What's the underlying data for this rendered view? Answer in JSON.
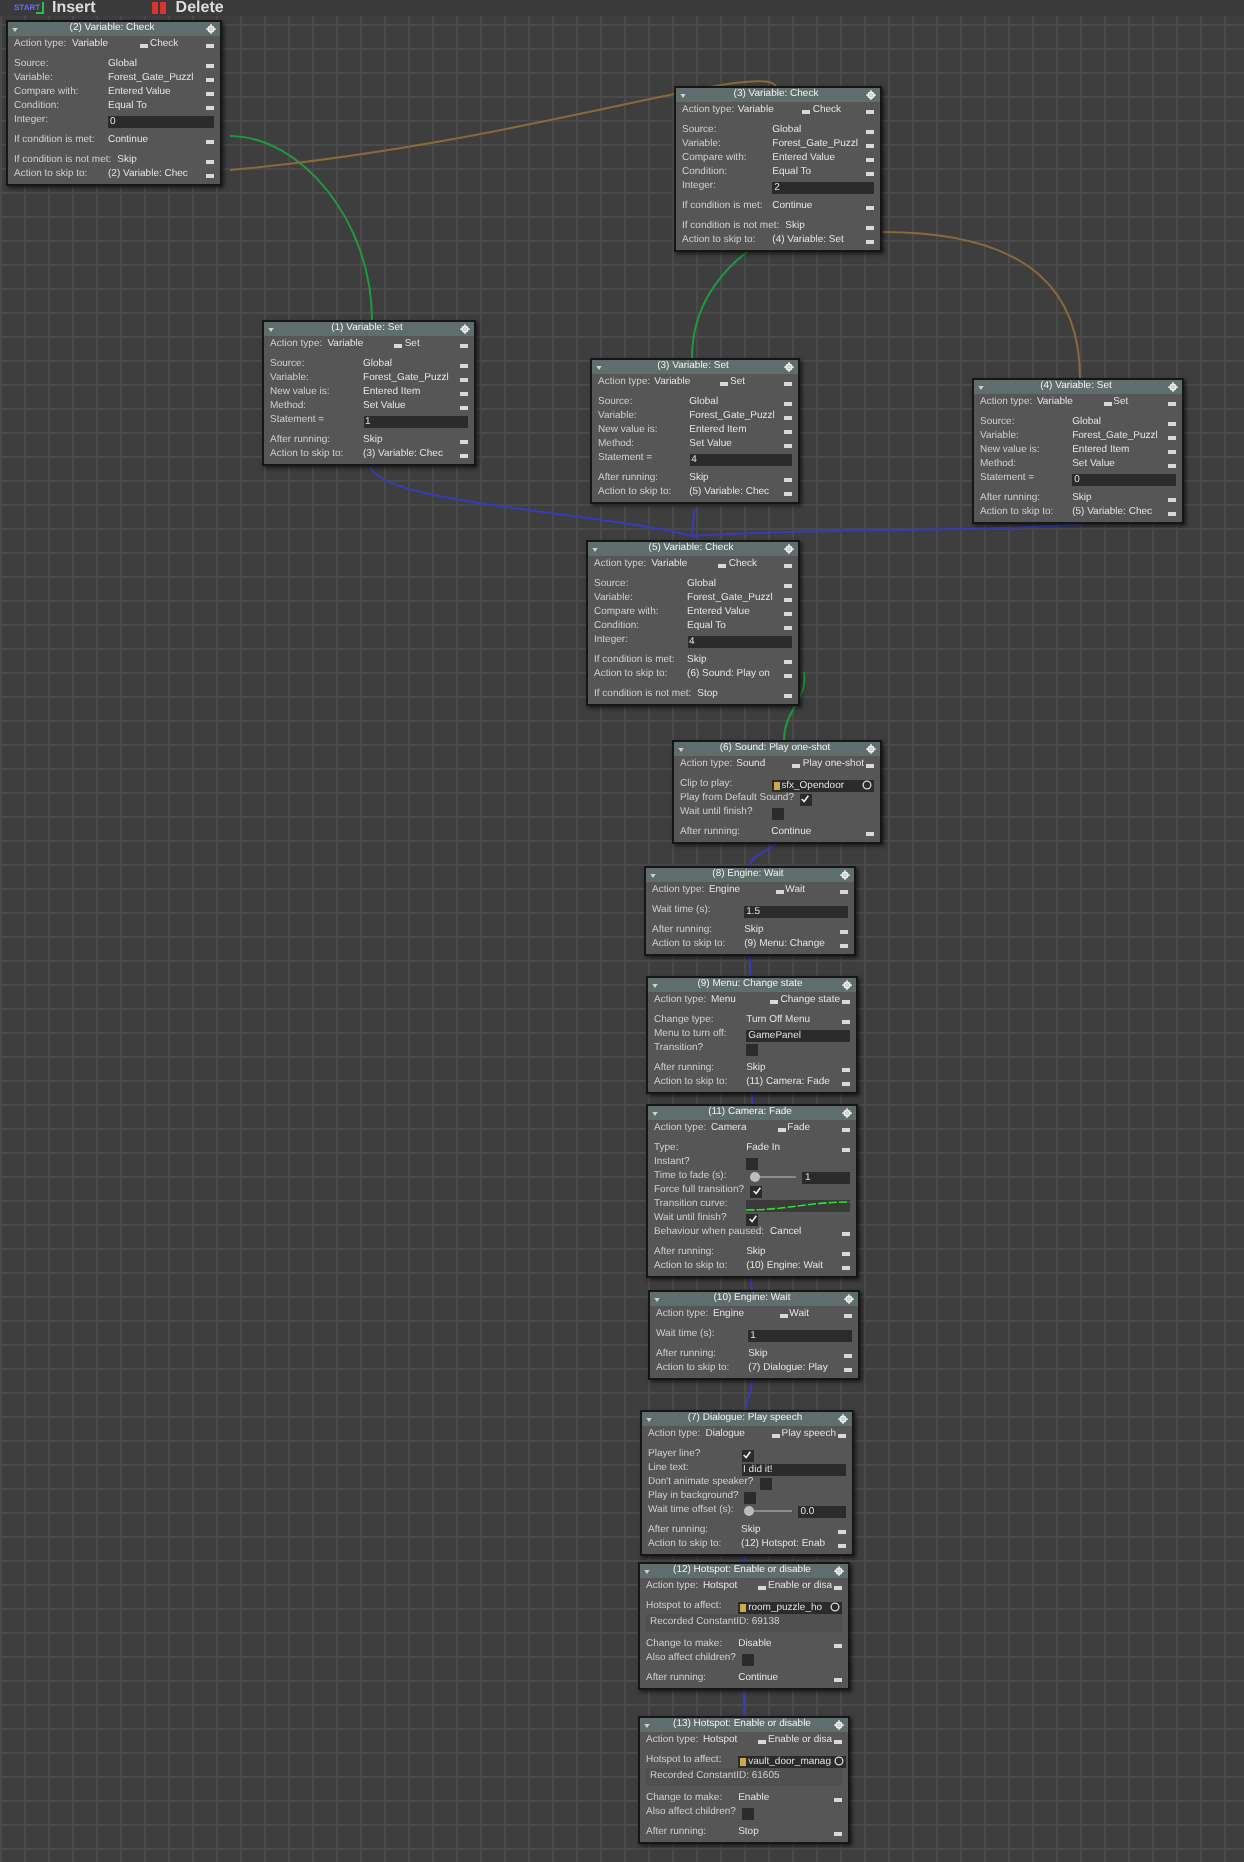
{
  "toolbar": [
    {
      "kind": "insert",
      "label": "Insert"
    },
    {
      "kind": "delete",
      "label": "Delete"
    }
  ],
  "start_label": "START",
  "nodes": [
    {
      "title": "(2) Variable: Check",
      "sections": [
        [
          {
            "kind": "pair",
            "label": "Action type:",
            "value": "Variable",
            "value2": "Check"
          }
        ],
        [
          {
            "kind": "select",
            "label": "Source:",
            "value": "Global"
          },
          {
            "kind": "select",
            "label": "Variable:",
            "value": "Forest_Gate_Puzzl"
          },
          {
            "kind": "select",
            "label": "Compare with:",
            "value": "Entered Value"
          },
          {
            "kind": "select",
            "label": "Condition:",
            "value": "Equal To"
          },
          {
            "kind": "input",
            "label": "Integer:",
            "value": "0"
          }
        ],
        [
          {
            "kind": "select",
            "label": "If condition is met:",
            "value": "Continue"
          }
        ],
        [
          {
            "kind": "select",
            "label": "If condition is not met:",
            "value": "Skip"
          },
          {
            "kind": "select",
            "label": "Action to skip to:",
            "value": "(2) Variable: Chec"
          }
        ]
      ]
    },
    {
      "title": "(3) Variable: Check",
      "sections": [
        [
          {
            "kind": "pair",
            "label": "Action type:",
            "value": "Variable",
            "value2": "Check"
          }
        ],
        [
          {
            "kind": "select",
            "label": "Source:",
            "value": "Global"
          },
          {
            "kind": "select",
            "label": "Variable:",
            "value": "Forest_Gate_Puzzl"
          },
          {
            "kind": "select",
            "label": "Compare with:",
            "value": "Entered Value"
          },
          {
            "kind": "select",
            "label": "Condition:",
            "value": "Equal To"
          },
          {
            "kind": "input",
            "label": "Integer:",
            "value": "2"
          }
        ],
        [
          {
            "kind": "select",
            "label": "If condition is met:",
            "value": "Continue"
          }
        ],
        [
          {
            "kind": "select",
            "label": "If condition is not met:",
            "value": "Skip"
          },
          {
            "kind": "select",
            "label": "Action to skip to:",
            "value": "(4) Variable: Set"
          }
        ]
      ]
    },
    {
      "title": "(1) Variable: Set",
      "sections": [
        [
          {
            "kind": "pair",
            "label": "Action type:",
            "value": "Variable",
            "value2": "Set"
          }
        ],
        [
          {
            "kind": "select",
            "label": "Source:",
            "value": "Global"
          },
          {
            "kind": "select",
            "label": "Variable:",
            "value": "Forest_Gate_Puzzl"
          },
          {
            "kind": "select",
            "label": "New value is:",
            "value": "Entered Item"
          },
          {
            "kind": "select",
            "label": "Method:",
            "value": "Set Value"
          },
          {
            "kind": "input",
            "label": "Statement =",
            "value": "1"
          }
        ],
        [
          {
            "kind": "select",
            "label": "After running:",
            "value": "Skip"
          },
          {
            "kind": "select",
            "label": "Action to skip to:",
            "value": "(3) Variable: Chec"
          }
        ]
      ]
    },
    {
      "title": "(3) Variable: Set",
      "sections": [
        [
          {
            "kind": "pair",
            "label": "Action type:",
            "value": "Variable",
            "value2": "Set"
          }
        ],
        [
          {
            "kind": "select",
            "label": "Source:",
            "value": "Global"
          },
          {
            "kind": "select",
            "label": "Variable:",
            "value": "Forest_Gate_Puzzl"
          },
          {
            "kind": "select",
            "label": "New value is:",
            "value": "Entered Item"
          },
          {
            "kind": "select",
            "label": "Method:",
            "value": "Set Value"
          },
          {
            "kind": "input",
            "label": "Statement =",
            "value": "4"
          }
        ],
        [
          {
            "kind": "select",
            "label": "After running:",
            "value": "Skip"
          },
          {
            "kind": "select",
            "label": "Action to skip to:",
            "value": "(5) Variable: Chec"
          }
        ]
      ]
    },
    {
      "title": "(4) Variable: Set",
      "sections": [
        [
          {
            "kind": "pair",
            "label": "Action type:",
            "value": "Variable",
            "value2": "Set"
          }
        ],
        [
          {
            "kind": "select",
            "label": "Source:",
            "value": "Global"
          },
          {
            "kind": "select",
            "label": "Variable:",
            "value": "Forest_Gate_Puzzl"
          },
          {
            "kind": "select",
            "label": "New value is:",
            "value": "Entered Item"
          },
          {
            "kind": "select",
            "label": "Method:",
            "value": "Set Value"
          },
          {
            "kind": "input",
            "label": "Statement =",
            "value": "0"
          }
        ],
        [
          {
            "kind": "select",
            "label": "After running:",
            "value": "Skip"
          },
          {
            "kind": "select",
            "label": "Action to skip to:",
            "value": "(5) Variable: Chec"
          }
        ]
      ]
    },
    {
      "title": "(5) Variable: Check",
      "sections": [
        [
          {
            "kind": "pair",
            "label": "Action type:",
            "value": "Variable",
            "value2": "Check"
          }
        ],
        [
          {
            "kind": "select",
            "label": "Source:",
            "value": "Global"
          },
          {
            "kind": "select",
            "label": "Variable:",
            "value": "Forest_Gate_Puzzl"
          },
          {
            "kind": "select",
            "label": "Compare with:",
            "value": "Entered Value"
          },
          {
            "kind": "select",
            "label": "Condition:",
            "value": "Equal To"
          },
          {
            "kind": "input",
            "label": "Integer:",
            "value": "4"
          }
        ],
        [
          {
            "kind": "select",
            "label": "If condition is met:",
            "value": "Skip"
          },
          {
            "kind": "select",
            "label": "Action to skip to:",
            "value": "(6) Sound: Play on"
          }
        ],
        [
          {
            "kind": "select",
            "label": "If condition is not met:",
            "value": "Stop"
          }
        ]
      ]
    },
    {
      "title": "(6) Sound: Play one-shot",
      "sections": [
        [
          {
            "kind": "pair",
            "label": "Action type:",
            "value": "Sound",
            "value2": "Play one-shot"
          }
        ],
        [
          {
            "kind": "asset",
            "label": "Clip to play:",
            "value": "sfx_Opendoor"
          },
          {
            "kind": "check",
            "label": "Play from Default Sound?",
            "checked": true
          },
          {
            "kind": "check",
            "label": "Wait until finish?",
            "checked": false
          }
        ],
        [
          {
            "kind": "select",
            "label": "After running:",
            "value": "Continue"
          }
        ]
      ]
    },
    {
      "title": "(8) Engine: Wait",
      "sections": [
        [
          {
            "kind": "pair",
            "label": "Action type:",
            "value": "Engine",
            "value2": "Wait"
          }
        ],
        [
          {
            "kind": "input",
            "label": "Wait time (s):",
            "value": "1.5"
          }
        ],
        [
          {
            "kind": "select",
            "label": "After running:",
            "value": "Skip"
          },
          {
            "kind": "select",
            "label": "Action to skip to:",
            "value": "(9) Menu: Change"
          }
        ]
      ]
    },
    {
      "title": "(9) Menu: Change state",
      "sections": [
        [
          {
            "kind": "pair",
            "label": "Action type:",
            "value": "Menu",
            "value2": "Change state"
          }
        ],
        [
          {
            "kind": "select",
            "label": "Change type:",
            "value": "Turn Off Menu"
          },
          {
            "kind": "input",
            "label": "Menu to turn off:",
            "value": "GamePanel"
          },
          {
            "kind": "check",
            "label": "Transition?",
            "checked": false
          }
        ],
        [
          {
            "kind": "select",
            "label": "After running:",
            "value": "Skip"
          },
          {
            "kind": "select",
            "label": "Action to skip to:",
            "value": "(11) Camera: Fade"
          }
        ]
      ]
    },
    {
      "title": "(11) Camera: Fade",
      "sections": [
        [
          {
            "kind": "pair",
            "label": "Action type:",
            "value": "Camera",
            "value2": "Fade"
          }
        ],
        [
          {
            "kind": "select",
            "label": "Type:",
            "value": "Fade In"
          },
          {
            "kind": "check",
            "label": "Instant?",
            "checked": false
          },
          {
            "kind": "slider",
            "label": "Time to fade (s):",
            "level": 0.1,
            "reading": "1"
          },
          {
            "kind": "check",
            "label": "Force full transition?",
            "checked": true
          },
          {
            "kind": "curve",
            "label": "Transition curve:"
          },
          {
            "kind": "check",
            "label": "Wait until finish?",
            "checked": true
          },
          {
            "kind": "select",
            "label": "Behaviour when paused:",
            "value": "Cancel"
          }
        ],
        [
          {
            "kind": "select",
            "label": "After running:",
            "value": "Skip"
          },
          {
            "kind": "select",
            "label": "Action to skip to:",
            "value": "(10) Engine: Wait"
          }
        ]
      ]
    },
    {
      "title": "(10) Engine: Wait",
      "sections": [
        [
          {
            "kind": "pair",
            "label": "Action type:",
            "value": "Engine",
            "value2": "Wait"
          }
        ],
        [
          {
            "kind": "input",
            "label": "Wait time (s):",
            "value": "1"
          }
        ],
        [
          {
            "kind": "select",
            "label": "After running:",
            "value": "Skip"
          },
          {
            "kind": "select",
            "label": "Action to skip to:",
            "value": "(7) Dialogue: Play"
          }
        ]
      ]
    },
    {
      "title": "(7) Dialogue: Play speech",
      "sections": [
        [
          {
            "kind": "pair",
            "label": "Action type:",
            "value": "Dialogue",
            "value2": "Play speech"
          }
        ],
        [
          {
            "kind": "check",
            "label": "Player line?",
            "checked": true
          },
          {
            "kind": "input",
            "label": "Line text:",
            "value": "I did it!"
          },
          {
            "kind": "check",
            "label": "Don't animate speaker?",
            "checked": false
          },
          {
            "kind": "check",
            "label": "Play in background?",
            "checked": false
          },
          {
            "kind": "slider",
            "label": "Wait time offset (s):",
            "level": 0.05,
            "reading": "0.0"
          }
        ],
        [
          {
            "kind": "select",
            "label": "After running:",
            "value": "Skip"
          },
          {
            "kind": "select",
            "label": "Action to skip to:",
            "value": "(12) Hotspot: Enab"
          }
        ]
      ]
    },
    {
      "title": "(12) Hotspot: Enable or disable",
      "sections": [
        [
          {
            "kind": "pair",
            "label": "Action type:",
            "value": "Hotspot",
            "value2": "Enable or disa"
          }
        ],
        [
          {
            "kind": "asset",
            "label": "Hotspot to affect:",
            "value": "room_puzzle_ho"
          },
          {
            "kind": "note",
            "text": "Recorded ConstantID: 69138"
          }
        ],
        [
          {
            "kind": "select",
            "label": "Change to make:",
            "value": "Disable"
          },
          {
            "kind": "check",
            "label": "Also affect children?",
            "checked": false
          }
        ],
        [
          {
            "kind": "select",
            "label": "After running:",
            "value": "Continue"
          }
        ]
      ]
    },
    {
      "title": "(13) Hotspot: Enable or disable",
      "sections": [
        [
          {
            "kind": "pair",
            "label": "Action type:",
            "value": "Hotspot",
            "value2": "Enable or disa"
          }
        ],
        [
          {
            "kind": "asset",
            "label": "Hotspot to affect:",
            "value": "vault_door_manag"
          },
          {
            "kind": "note",
            "text": "Recorded ConstantID: 61605"
          }
        ],
        [
          {
            "kind": "select",
            "label": "Change to make:",
            "value": "Enable"
          },
          {
            "kind": "check",
            "label": "Also affect children?",
            "checked": false
          }
        ],
        [
          {
            "kind": "select",
            "label": "After running:",
            "value": "Stop"
          }
        ]
      ]
    }
  ]
}
